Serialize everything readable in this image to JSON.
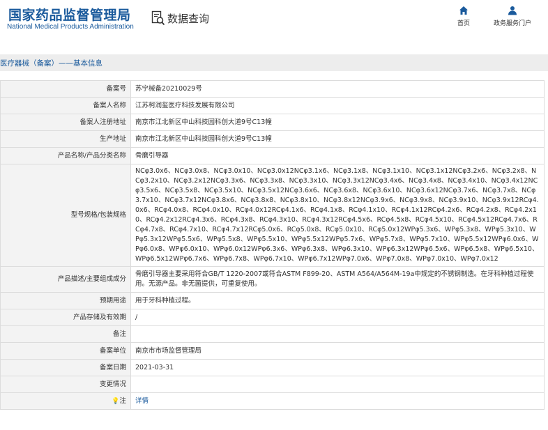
{
  "header": {
    "logo_cn": "国家药品监督管理局",
    "logo_en": "National Medical Products Administration",
    "query_label": "数据查询",
    "nav": [
      {
        "label": "首页",
        "icon": "home-icon"
      },
      {
        "label": "政务服务门户",
        "icon": "user-icon"
      }
    ]
  },
  "breadcrumb": "医疗器械（备案）——基本信息",
  "colors": {
    "brand": "#1a5a9c",
    "label_bg": "#f3f3f3",
    "border": "#dcdcdc",
    "breadcrumb_bg": "#ededed"
  },
  "rows": [
    {
      "label": "备案号",
      "value": "苏宁械备20210029号"
    },
    {
      "label": "备案人名称",
      "value": "江苏柯润玺医疗科技发展有限公司"
    },
    {
      "label": "备案人注册地址",
      "value": "南京市江北新区中山科技园科创大道9号C13幢"
    },
    {
      "label": "生产地址",
      "value": "南京市江北新区中山科技园科创大道9号C13幢"
    },
    {
      "label": "产品名称/产品分类名称",
      "value": "骨磨引导器"
    },
    {
      "label": "型号规格/包装规格",
      "value": "NCφ3.0x6、NCφ3.0x8、NCφ3.0x10、NCφ3.0x12NCφ3.1x6、NCφ3.1x8、NCφ3.1x10、NCφ3.1x12NCφ3.2x6、NCφ3.2x8、NCφ3.2x10、NCφ3.2x12NCφ3.3x6、NCφ3.3x8、NCφ3.3x10、NCφ3.3x12NCφ3.4x6、NCφ3.4x8、NCφ3.4x10、NCφ3.4x12NCφ3.5x6、NCφ3.5x8、NCφ3.5x10、NCφ3.5x12NCφ3.6x6、NCφ3.6x8、NCφ3.6x10、NCφ3.6x12NCφ3.7x6、NCφ3.7x8、NCφ3.7x10、NCφ3.7x12NCφ3.8x6、NCφ3.8x8、NCφ3.8x10、NCφ3.8x12NCφ3.9x6、NCφ3.9x8、NCφ3.9x10、NCφ3.9x12RCφ4.0x6、RCφ4.0x8、RCφ4.0x10、RCφ4.0x12RCφ4.1x6、RCφ4.1x8、RCφ4.1x10、RCφ4.1x12RCφ4.2x6、RCφ4.2x8、RCφ4.2x10、RCφ4.2x12RCφ4.3x6、RCφ4.3x8、RCφ4.3x10、RCφ4.3x12RCφ4.5x6、RCφ4.5x8、RCφ4.5x10、RCφ4.5x12RCφ4.7x6、RCφ4.7x8、RCφ4.7x10、RCφ4.7x12RCφ5.0x6、RCφ5.0x8、RCφ5.0x10、RCφ5.0x12WPφ5.3x6、WPφ5.3x8、WPφ5.3x10、WPφ5.3x12WPφ5.5x6、WPφ5.5x8、WPφ5.5x10、WPφ5.5x12WPφ5.7x6、WPφ5.7x8、WPφ5.7x10、WPφ5.5x12WPφ6.0x6、WPφ6.0x8、WPφ6.0x10、WPφ6.0x12WPφ6.3x6、WPφ6.3x8、WPφ6.3x10、WPφ6.3x12WPφ6.5x6、WPφ6.5x8、WPφ6.5x10、WPφ6.5x12WPφ6.7x6、WPφ6.7x8、WPφ6.7x10、WPφ6.7x12WPφ7.0x6、WPφ7.0x8、WPφ7.0x10、WPφ7.0x12"
    },
    {
      "label": "产品描述/主要组成成分",
      "value": "骨磨引导器主要采用符合GB/T 1220-2007或符合ASTM F899-20、ASTM A564/A564M-19a中规定的不锈钢制造。在牙科种植过程使用。无源产品。非无菌提供，可重复使用。"
    },
    {
      "label": "预期用途",
      "value": "用于牙科种植过程。"
    },
    {
      "label": "产品存储及有效期",
      "value": "/"
    },
    {
      "label": "备注",
      "value": ""
    },
    {
      "label": "备案单位",
      "value": "南京市市场监督管理局"
    },
    {
      "label": "备案日期",
      "value": "2021-03-31"
    },
    {
      "label": "变更情况",
      "value": ""
    },
    {
      "label": "注",
      "value": "详情",
      "icon": "bulb-icon"
    }
  ]
}
